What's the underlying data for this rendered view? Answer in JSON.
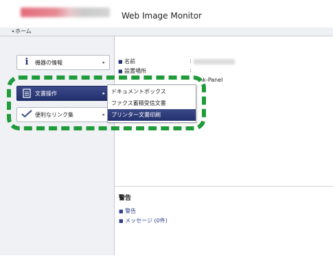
{
  "header": {
    "app_title": "Web Image Monitor"
  },
  "breadcrumb": {
    "home_label": "ホーム",
    "arrow": "◂"
  },
  "sidebar": {
    "items": [
      {
        "label": "機器の情報",
        "icon": "info-icon",
        "chevron": "▸"
      },
      {
        "label": "文書操作",
        "icon": "document-icon",
        "chevron": "▸"
      },
      {
        "label": "便利なリンク集",
        "icon": "link-check-icon",
        "chevron": "▸"
      }
    ]
  },
  "submenu": {
    "items": [
      {
        "label": "ドキュメントボックス"
      },
      {
        "label": "ファクス蓄積受信文書"
      },
      {
        "label": "プリンター文書印刷"
      }
    ],
    "selected_index": 2
  },
  "info": {
    "rows": [
      {
        "label": "名前"
      },
      {
        "label": "設置場所"
      }
    ],
    "model_text": "ink-Panel"
  },
  "alerts": {
    "title": "警告",
    "items": [
      {
        "label": "警告"
      },
      {
        "label": "メッセージ (0件)"
      }
    ]
  },
  "colors": {
    "accent": "#22306e",
    "highlight": "#1f9b3a"
  }
}
